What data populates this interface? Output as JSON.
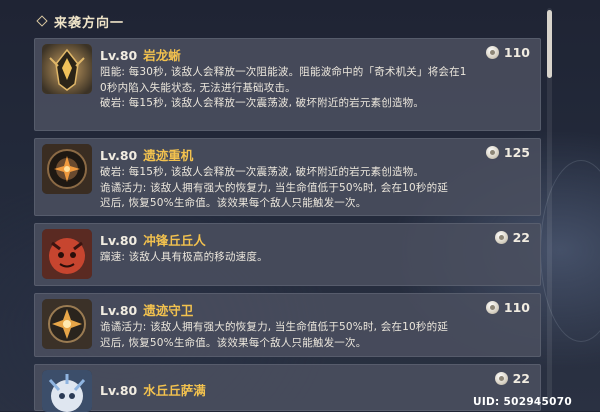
{
  "header": {
    "title": "来袭方向一"
  },
  "enemies": [
    {
      "level": "Lv.80",
      "name": "岩龙蜥",
      "points": "110",
      "lines": [
        "阻能: 每30秒, 该敌人会释放一次阻能波。阻能波命中的「奇术机关」将会在1",
        "0秒内陷入失能状态, 无法进行基础攻击。",
        "破岩: 每15秒, 该敌人会释放一次震荡波, 破坏附近的岩元素创造物。"
      ],
      "portrait_icon": "rock-lizard-icon"
    },
    {
      "level": "Lv.80",
      "name": "遗迹重机",
      "points": "125",
      "lines": [
        "破岩: 每15秒, 该敌人会释放一次震荡波, 破坏附近的岩元素创造物。",
        "诡谲活力: 该敌人拥有强大的恢复力, 当生命值低于50%时, 会在10秒的延",
        "迟后, 恢复50%生命值。该效果每个敌人只能触发一次。"
      ],
      "portrait_icon": "ruin-grader-icon"
    },
    {
      "level": "Lv.80",
      "name": "冲锋丘丘人",
      "points": "22",
      "lines": [
        "蹿速: 该敌人具有极高的移动速度。"
      ],
      "portrait_icon": "hilichurl-icon"
    },
    {
      "level": "Lv.80",
      "name": "遗迹守卫",
      "points": "110",
      "lines": [
        "诡谲活力: 该敌人拥有强大的恢复力, 当生命值低于50%时, 会在10秒的延",
        "迟后, 恢复50%生命值。该效果每个敌人只能触发一次。"
      ],
      "portrait_icon": "ruin-guard-icon"
    },
    {
      "level": "Lv.80",
      "name": "水丘丘萨满",
      "points": "22",
      "lines": [],
      "portrait_icon": "hydro-samachurl-icon"
    }
  ],
  "footer": {
    "uid": "UID: 502945070"
  },
  "colors": {
    "name_accent": "#f3c24e",
    "card_bg": "#4a4f5e"
  }
}
